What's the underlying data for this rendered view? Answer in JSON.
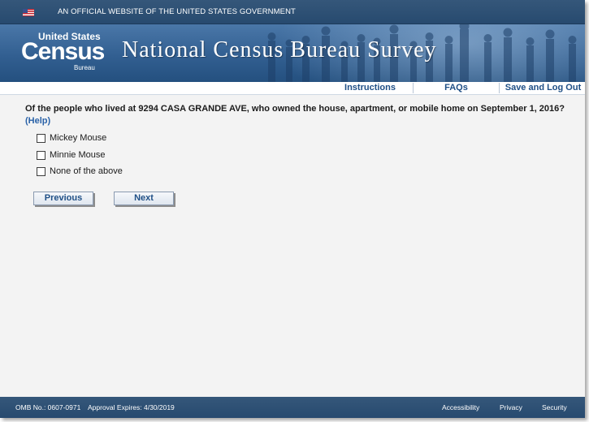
{
  "gov_banner": {
    "text": "AN OFFICIAL WEBSITE OF THE UNITED STATES GOVERNMENT",
    "flag_icon": "us-flag-icon"
  },
  "header": {
    "logo": {
      "top": "United States",
      "main": "Census",
      "sub": "Bureau"
    },
    "title": "National Census Bureau Survey"
  },
  "nav": {
    "items": [
      {
        "label": "Instructions"
      },
      {
        "label": "FAQs"
      },
      {
        "label": "Save and Log Out"
      }
    ]
  },
  "question": {
    "text": "Of the people who lived at 9294 CASA GRANDE AVE, who owned the house, apartment, or mobile home on September 1, 2016?",
    "help_label": "(Help)",
    "options": [
      {
        "label": "Mickey Mouse",
        "checked": false
      },
      {
        "label": "Minnie Mouse",
        "checked": false
      },
      {
        "label": "None of the above",
        "checked": false
      }
    ]
  },
  "buttons": {
    "previous": "Previous",
    "next": "Next"
  },
  "footer": {
    "omb": "OMB No.: 0607-0971",
    "approval": "Approval Expires: 4/30/2019",
    "links": [
      "Accessibility",
      "Privacy",
      "Security"
    ]
  },
  "colors": {
    "header_blue": "#274a6f",
    "link_blue": "#1f4f86",
    "background": "#f3f3f3"
  }
}
